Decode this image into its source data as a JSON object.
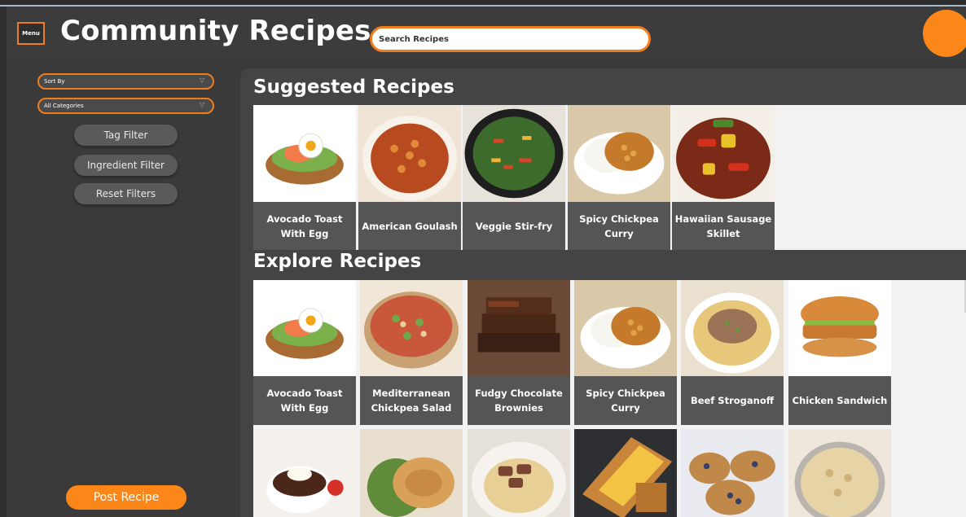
{
  "header": {
    "menu_label": "Menu",
    "title": "Community Recipes",
    "search_placeholder": "Search Recipes"
  },
  "sidebar": {
    "sort_by": "Sort By",
    "category": "All Categories",
    "buttons": [
      "Tag Filter",
      "Ingredient Filter",
      "Reset Filters"
    ],
    "post_label": "Post Recipe"
  },
  "suggested": {
    "title": "Suggested Recipes",
    "recipes": [
      {
        "name": "Avocado Toast With Egg",
        "icon": "avocado-toast-photo"
      },
      {
        "name": "American Goulash",
        "icon": "goulash-photo"
      },
      {
        "name": "Veggie Stir-fry",
        "icon": "stir-fry-photo"
      },
      {
        "name": "Spicy Chickpea Curry",
        "icon": "chickpea-curry-photo"
      },
      {
        "name": "Hawaiian Sausage Skillet",
        "icon": "sausage-skillet-photo"
      }
    ]
  },
  "explore": {
    "title": "Explore Recipes",
    "recipes": [
      {
        "name": "Avocado Toast With Egg",
        "icon": "avocado-toast-photo"
      },
      {
        "name": "Mediterranean Chickpea Salad",
        "icon": "chickpea-salad-photo"
      },
      {
        "name": "Fudgy Chocolate Brownies",
        "icon": "brownies-photo"
      },
      {
        "name": "Spicy Chickpea Curry",
        "icon": "chickpea-curry-photo"
      },
      {
        "name": "Beef Stroganoff",
        "icon": "stroganoff-photo"
      },
      {
        "name": "Chicken Sandwich",
        "icon": "chicken-sandwich-photo"
      }
    ],
    "second_row_icons": [
      "lava-cake-photo",
      "pork-chop-photo",
      "steak-pasta-photo",
      "grilled-cheese-photo",
      "muffins-photo",
      "pasta-bowl-photo"
    ]
  },
  "colors": {
    "accent": "#fd8618",
    "background": "#3a3a3a"
  }
}
